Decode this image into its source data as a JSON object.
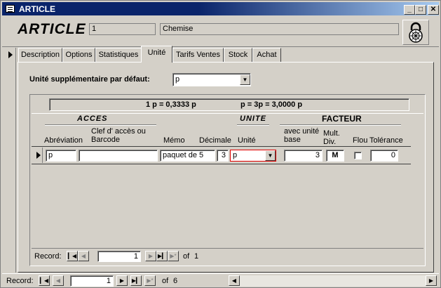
{
  "window": {
    "title": "ARTICLE",
    "controls": {
      "minimize": "_",
      "maximize": "□",
      "close": "✕"
    }
  },
  "header": {
    "form_title": "ARTICLE",
    "code": "1",
    "name": "Chemise"
  },
  "tabs": [
    {
      "label": "Description"
    },
    {
      "label": "Options"
    },
    {
      "label": "Statistiques"
    },
    {
      "label": "Unité"
    },
    {
      "label": "Tarifs Ventes"
    },
    {
      "label": "Stock"
    },
    {
      "label": "Achat"
    }
  ],
  "active_tab": "Unité",
  "default_unit": {
    "label": "Unité supplémentaire par défaut:",
    "value": "p"
  },
  "conversion": {
    "left": "1 p = 0,3333 p",
    "right": "p = 3p = 3,0000 p"
  },
  "subform": {
    "group_headers": {
      "acces": "ACCES",
      "unite": "UNITE",
      "facteur": "FACTEUR"
    },
    "columns": {
      "abreviation": "Abréviation",
      "clef": "Clef d' accès ou Barcode",
      "memo": "Mémo",
      "decimale": "Décimale",
      "unite": "Unité",
      "avec": "avec unité base",
      "mult": "Mult. Div.",
      "flou": "Flou",
      "tolerance": "Tolérance"
    },
    "row": {
      "abreviation": "p",
      "clef": "",
      "memo": "paquet de 5",
      "decimale": "3",
      "unite": "p",
      "avec": "3",
      "mult": "M",
      "flou": false,
      "tolerance": "0"
    },
    "nav": {
      "label": "Record:",
      "current": "1",
      "of": "of",
      "total": "1"
    }
  },
  "main_nav": {
    "label": "Record:",
    "current": "1",
    "of": "of",
    "total": "6"
  }
}
